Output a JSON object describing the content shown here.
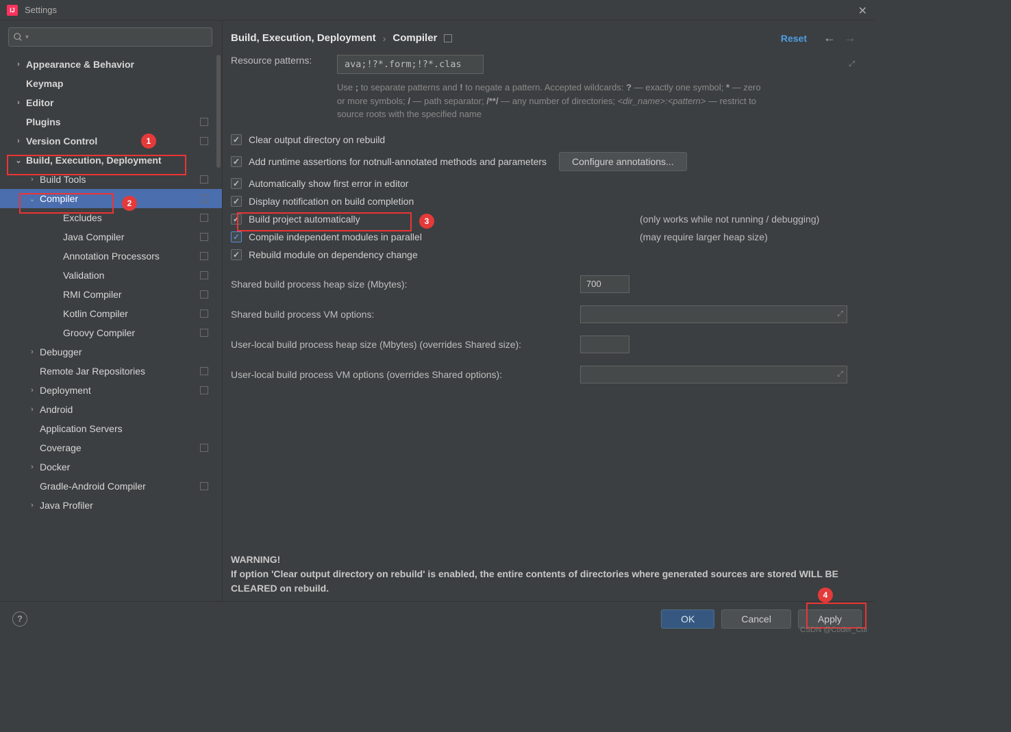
{
  "window": {
    "title": "Settings"
  },
  "search": {
    "placeholder": ""
  },
  "sidebar": {
    "items": [
      {
        "label": "Appearance & Behavior",
        "chev": "right",
        "bold": true,
        "depth": 0
      },
      {
        "label": "Keymap",
        "chev": "none",
        "bold": true,
        "depth": 0
      },
      {
        "label": "Editor",
        "chev": "right",
        "bold": true,
        "depth": 0
      },
      {
        "label": "Plugins",
        "chev": "none",
        "bold": true,
        "depth": 0,
        "proj": true
      },
      {
        "label": "Version Control",
        "chev": "right",
        "bold": true,
        "depth": 0,
        "proj": true
      },
      {
        "label": "Build, Execution, Deployment",
        "chev": "down",
        "bold": true,
        "depth": 0
      },
      {
        "label": "Build Tools",
        "chev": "right",
        "depth": 1,
        "proj": true
      },
      {
        "label": "Compiler",
        "chev": "down",
        "depth": 1,
        "proj": true,
        "selected": true
      },
      {
        "label": "Excludes",
        "chev": "none",
        "depth": 3,
        "proj": true
      },
      {
        "label": "Java Compiler",
        "chev": "none",
        "depth": 3,
        "proj": true
      },
      {
        "label": "Annotation Processors",
        "chev": "none",
        "depth": 3,
        "proj": true
      },
      {
        "label": "Validation",
        "chev": "none",
        "depth": 3,
        "proj": true
      },
      {
        "label": "RMI Compiler",
        "chev": "none",
        "depth": 3,
        "proj": true
      },
      {
        "label": "Kotlin Compiler",
        "chev": "none",
        "depth": 3,
        "proj": true
      },
      {
        "label": "Groovy Compiler",
        "chev": "none",
        "depth": 3,
        "proj": true
      },
      {
        "label": "Debugger",
        "chev": "right",
        "depth": 1
      },
      {
        "label": "Remote Jar Repositories",
        "chev": "none",
        "depth": 1,
        "proj": true
      },
      {
        "label": "Deployment",
        "chev": "right",
        "depth": 1,
        "proj": true
      },
      {
        "label": "Android",
        "chev": "right",
        "depth": 1
      },
      {
        "label": "Application Servers",
        "chev": "none",
        "depth": 1
      },
      {
        "label": "Coverage",
        "chev": "none",
        "depth": 1,
        "proj": true
      },
      {
        "label": "Docker",
        "chev": "right",
        "depth": 1
      },
      {
        "label": "Gradle-Android Compiler",
        "chev": "none",
        "depth": 1,
        "proj": true
      },
      {
        "label": "Java Profiler",
        "chev": "right",
        "depth": 1
      }
    ]
  },
  "breadcrumb": {
    "root": "Build, Execution, Deployment",
    "leaf": "Compiler",
    "reset": "Reset"
  },
  "form": {
    "resource_label": "Resource patterns:",
    "resource_value": "ava;!?*.form;!?*.class;!?*.groovy;!?*.scala;!?*.flex;!?*.kt;!?*.clj;!?*.aj",
    "checks": [
      {
        "label": "Clear output directory on rebuild",
        "checked": true
      },
      {
        "label": "Add runtime assertions for notnull-annotated methods and parameters",
        "checked": true,
        "btn": "Configure annotations..."
      },
      {
        "label": "Automatically show first error in editor",
        "checked": true
      },
      {
        "label": "Display notification on build completion",
        "checked": true
      },
      {
        "label": "Build project automatically",
        "checked": true,
        "note": "(only works while not running / debugging)"
      },
      {
        "label": "Compile independent modules in parallel",
        "checked": true,
        "blue": true,
        "note": "(may require larger heap size)"
      },
      {
        "label": "Rebuild module on dependency change",
        "checked": true
      }
    ],
    "fields": [
      {
        "label": "Shared build process heap size (Mbytes):",
        "value": "700",
        "mode": "small"
      },
      {
        "label": "Shared build process VM options:",
        "value": "",
        "mode": "wide"
      },
      {
        "label": "User-local build process heap size (Mbytes) (overrides Shared size):",
        "value": "",
        "mode": "small"
      },
      {
        "label": "User-local build process VM options (overrides Shared options):",
        "value": "",
        "mode": "wide"
      }
    ],
    "warning_head": "WARNING!",
    "warning_body": "If option 'Clear output directory on rebuild' is enabled, the entire contents of directories where generated sources are stored WILL BE CLEARED on rebuild."
  },
  "help_text": {
    "t1": "Use ",
    "semi": ";",
    "t2": " to separate patterns and ",
    "bang": "!",
    "t3": " to negate a pattern. Accepted wildcards: ",
    "q": "?",
    "t4": " — exactly one symbol; ",
    "star": "*",
    "t5": " — zero or more symbols; ",
    "slash": "/",
    "t6": " — path separator; ",
    "dstar": "/**/",
    "t7": " — any number of directories; ",
    "dp": "<dir_name>:<pattern>",
    "t8": " — restrict to source roots with the specified name"
  },
  "buttons": {
    "ok": "OK",
    "cancel": "Cancel",
    "apply": "Apply"
  },
  "annotations": {
    "n1": "1",
    "n2": "2",
    "n3": "3",
    "n4": "4"
  },
  "watermark": "CSDN @Coder_Cui"
}
